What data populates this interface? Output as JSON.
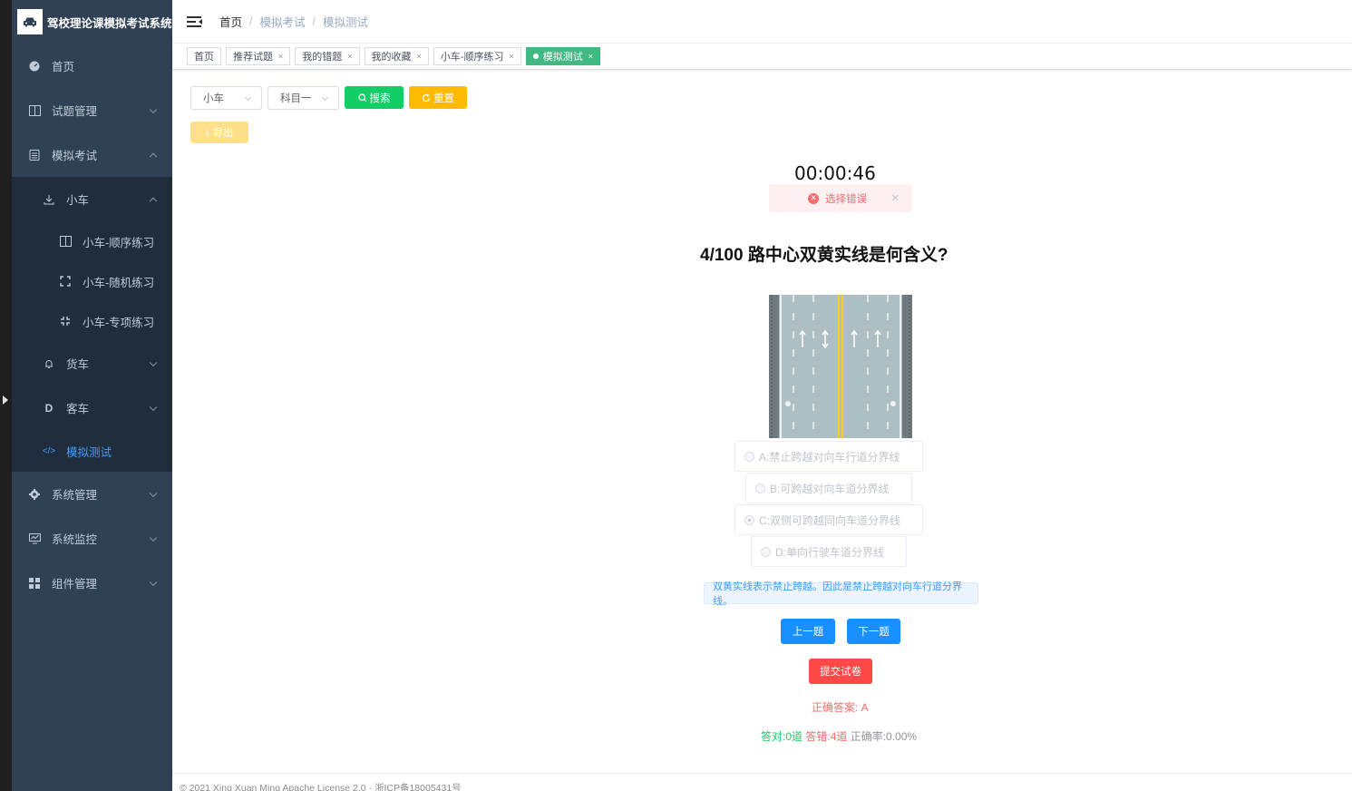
{
  "app": {
    "title": "驾校理论课模拟考试系统"
  },
  "sidebar": {
    "items": [
      {
        "label": "首页"
      },
      {
        "label": "试题管理"
      },
      {
        "label": "模拟考试"
      },
      {
        "label": "小车"
      },
      {
        "label": "小车-顺序练习"
      },
      {
        "label": "小车-随机练习"
      },
      {
        "label": "小车-专项练习"
      },
      {
        "label": "货车"
      },
      {
        "label": "客车"
      },
      {
        "label": "模拟测试"
      },
      {
        "label": "系统管理"
      },
      {
        "label": "系统监控"
      },
      {
        "label": "组件管理"
      }
    ]
  },
  "breadcrumb": [
    "首页",
    "模拟考试",
    "模拟测试"
  ],
  "tabs": [
    {
      "label": "首页"
    },
    {
      "label": "推荐试题"
    },
    {
      "label": "我的错题"
    },
    {
      "label": "我的收藏"
    },
    {
      "label": "小车-顺序练习"
    },
    {
      "label": "模拟测试"
    }
  ],
  "filters": {
    "vehicle": "小车",
    "subject": "科目一",
    "search_label": "搜索",
    "reset_label": "重置",
    "export_label": "导出"
  },
  "exam": {
    "timer": "00:00:46",
    "alert": "选择错误",
    "question": "4/100 路中心双黄实线是何含义?",
    "options": [
      {
        "label": "A:禁止跨越对向车行道分界线"
      },
      {
        "label": "B:可跨越对向车道分界线"
      },
      {
        "label": "C:双侧可跨越同向车道分界线",
        "selected": true
      },
      {
        "label": "D:单向行驶车道分界线"
      }
    ],
    "explanation": "双黄实线表示禁止跨越。因此是禁止跨越对向车行道分界线。",
    "prev_label": "上一题",
    "next_label": "下一题",
    "submit_label": "提交试卷",
    "correct_answer": "正确答案: A",
    "stats": {
      "right": "答对:0道",
      "wrong": "答错:4道",
      "rate": "正确率:0.00%"
    }
  },
  "footer": "© 2021 Xing Xuan Ming Apache License 2.0 · 浙ICP备18005431号",
  "colors": {
    "sidebar_bg": "#304156",
    "submenu_bg": "#1f2d3d",
    "active_tag": "#42b983",
    "primary": "#1890ff",
    "danger": "#ff4949",
    "success": "#13ce66",
    "warning": "#ffba00"
  }
}
